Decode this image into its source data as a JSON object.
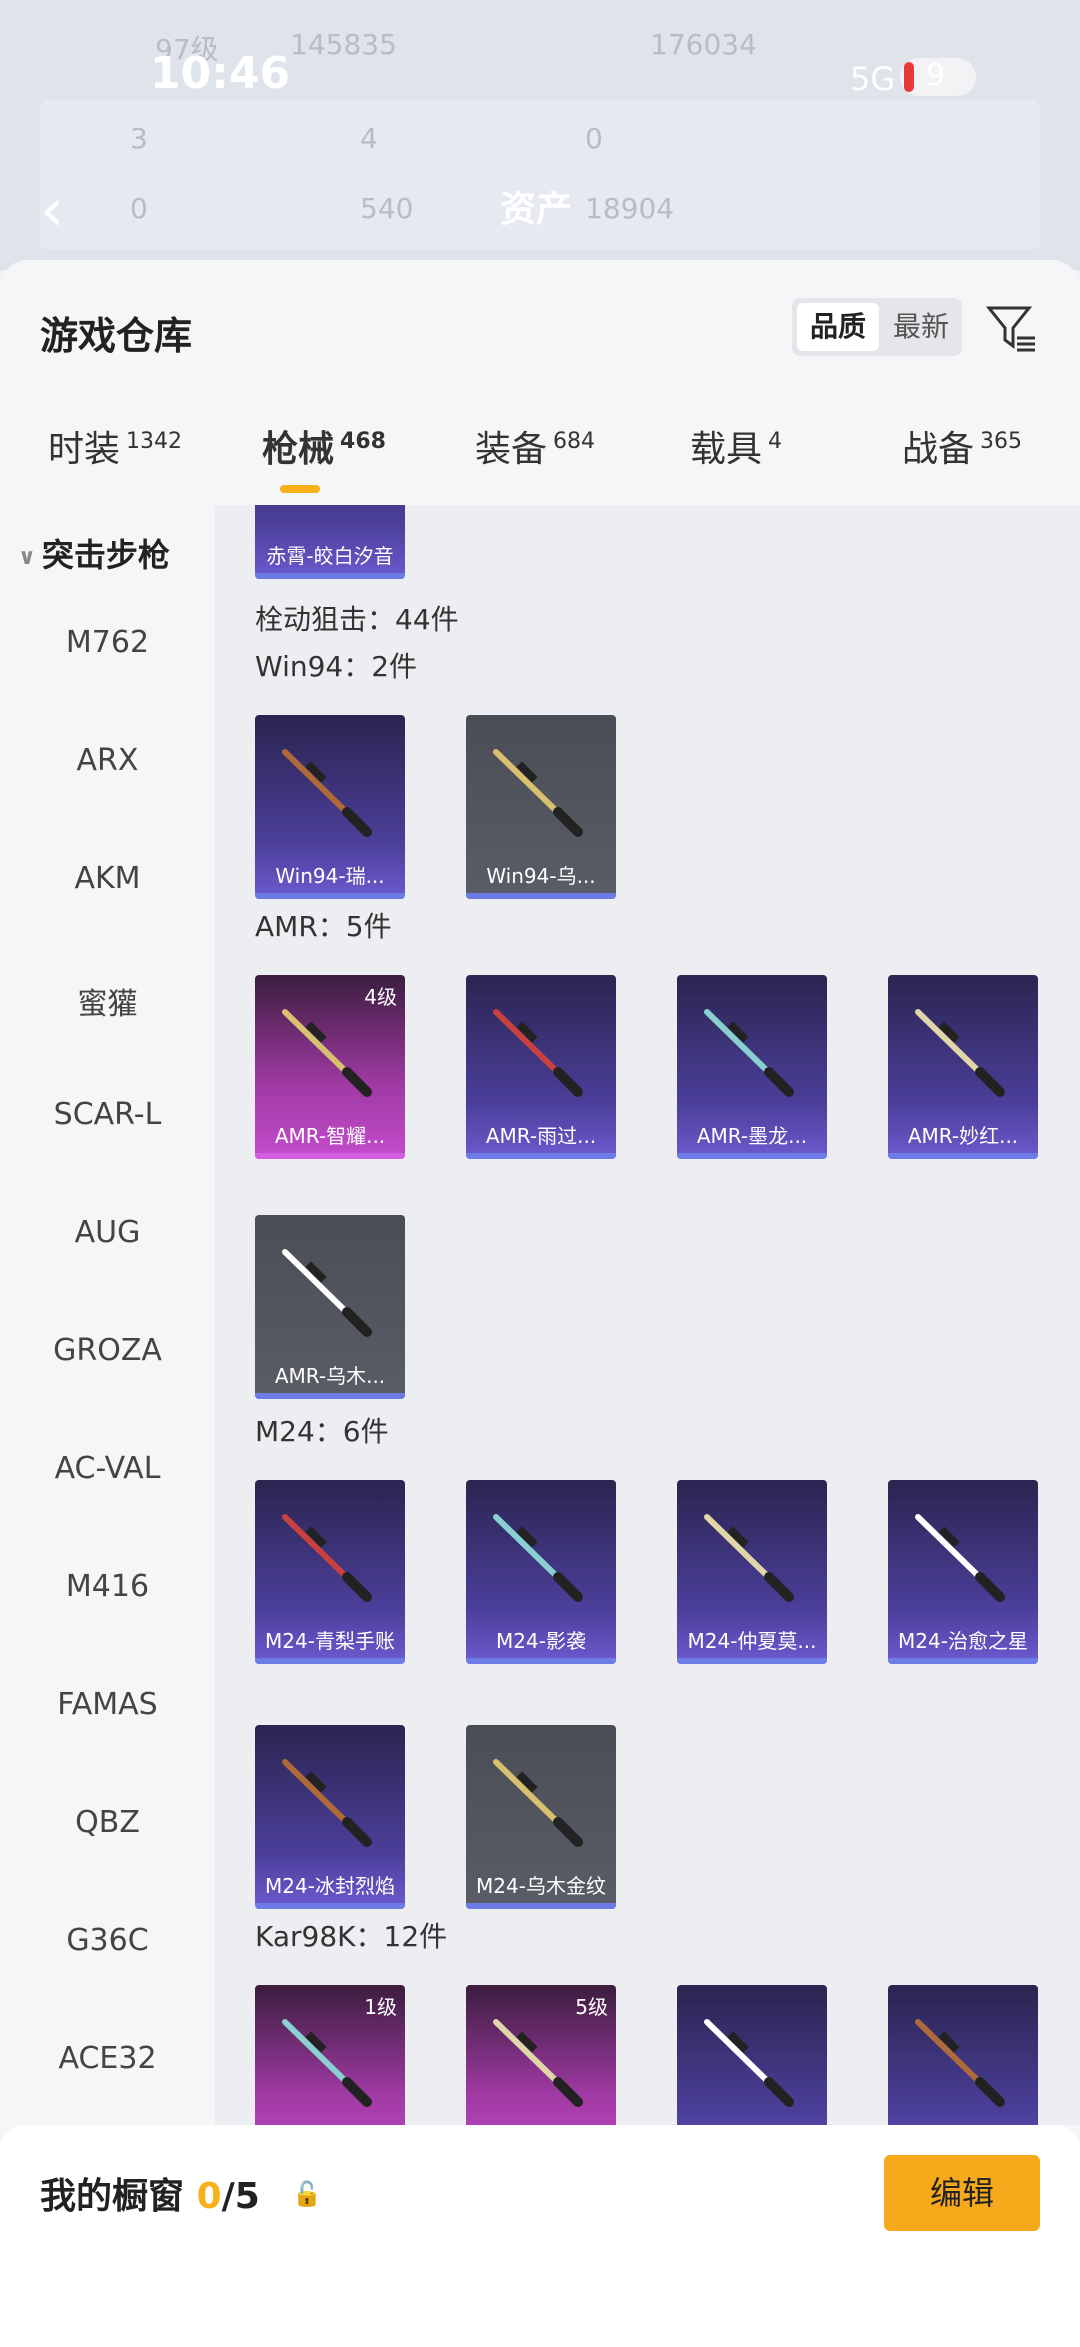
{
  "status": {
    "time": "10:46",
    "network": "5G",
    "battery": "9"
  },
  "background": {
    "level": "97级",
    "score1": "145835",
    "score2": "176034",
    "stats": [
      "3",
      "4",
      "0",
      "0",
      "540"
    ],
    "asset_label": "资产",
    "asset_value": "18904"
  },
  "header": {
    "title": "游戏仓库",
    "sort_active": "品质",
    "sort_other": "最新"
  },
  "tabs": [
    {
      "label": "时装",
      "count": "1342"
    },
    {
      "label": "枪械",
      "count": "468"
    },
    {
      "label": "装备",
      "count": "684"
    },
    {
      "label": "载具",
      "count": "4"
    },
    {
      "label": "战备",
      "count": "365"
    }
  ],
  "sidebar": {
    "heading": "突击步枪",
    "items": [
      "M762",
      "ARX",
      "AKM",
      "蜜獾",
      "SCAR-L",
      "AUG",
      "GROZA",
      "AC-VAL",
      "M416",
      "FAMAS",
      "QBZ",
      "G36C",
      "ACE32"
    ]
  },
  "content": {
    "top_card_name": "赤霄-皎白汐音",
    "category": "栓动狙击：44件",
    "sections": [
      {
        "title": "Win94：2件",
        "items": [
          {
            "name": "Win94-瑞...",
            "style": "purple",
            "level": ""
          },
          {
            "name": "Win94-乌...",
            "style": "gray",
            "level": ""
          }
        ]
      },
      {
        "title": "AMR：5件",
        "items": [
          {
            "name": "AMR-智耀...",
            "style": "magenta",
            "level": "4级"
          },
          {
            "name": "AMR-雨过...",
            "style": "purple",
            "level": ""
          },
          {
            "name": "AMR-墨龙...",
            "style": "purple",
            "level": ""
          },
          {
            "name": "AMR-妙红...",
            "style": "purple",
            "level": ""
          },
          {
            "name": "AMR-乌木...",
            "style": "gray",
            "level": ""
          }
        ]
      },
      {
        "title": "M24：6件",
        "items": [
          {
            "name": "M24-青梨手账",
            "style": "purple",
            "level": ""
          },
          {
            "name": "M24-影袭",
            "style": "purple",
            "level": ""
          },
          {
            "name": "M24-仲夏莫...",
            "style": "purple",
            "level": ""
          },
          {
            "name": "M24-治愈之星",
            "style": "purple",
            "level": ""
          },
          {
            "name": "M24-冰封烈焰",
            "style": "purple",
            "level": ""
          },
          {
            "name": "M24-乌木金纹",
            "style": "gray",
            "level": ""
          }
        ]
      },
      {
        "title": "Kar98K：12件",
        "items": [
          {
            "name": "",
            "style": "magenta",
            "level": "1级"
          },
          {
            "name": "",
            "style": "magenta",
            "level": "5级"
          },
          {
            "name": "",
            "style": "purple",
            "level": ""
          },
          {
            "name": "",
            "style": "purple",
            "level": ""
          }
        ]
      }
    ]
  },
  "showcase": {
    "label": "我的橱窗",
    "count_current": "0",
    "count_total": "/5",
    "edit_label": "编辑"
  },
  "colors": {
    "accent": "#f7b21b",
    "card_purple": "#4b3f9a",
    "card_magenta": "#a03aa4",
    "card_gray": "#5a5d66"
  }
}
